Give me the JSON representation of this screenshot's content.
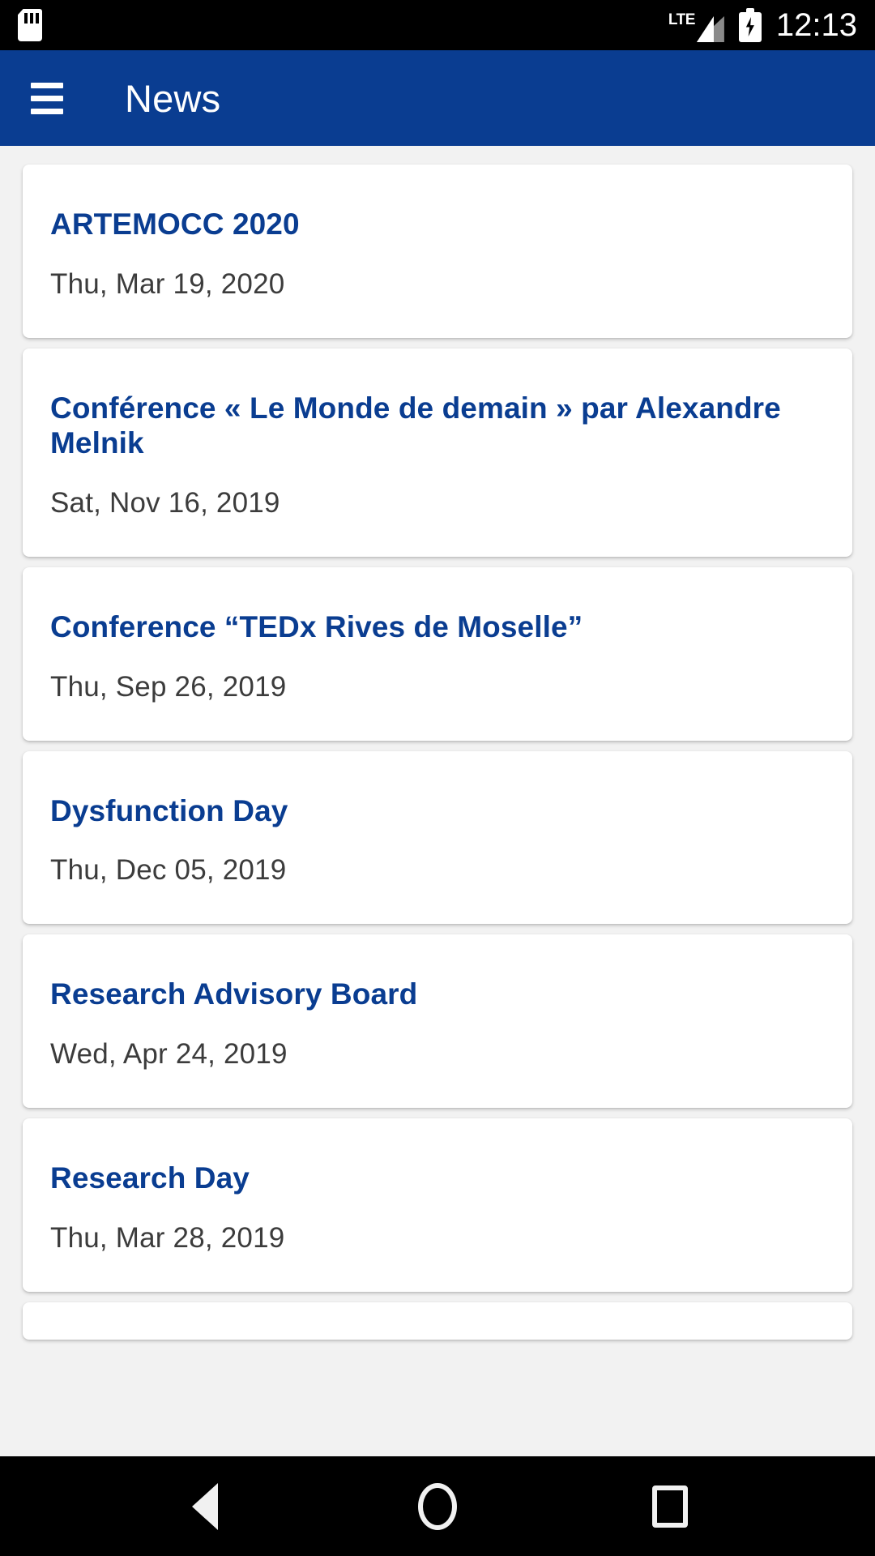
{
  "status_bar": {
    "sd_card_icon": "sd-card-icon",
    "network_label": "LTE",
    "signal_icon": "signal-bars-icon",
    "battery_icon": "battery-charging-icon",
    "time": "12:13"
  },
  "toolbar": {
    "menu_icon": "hamburger-menu-icon",
    "title": "News"
  },
  "theme": {
    "primary": "#0a3d91",
    "background": "#f2f2f2",
    "card": "#ffffff",
    "title_text": "#0a3d91",
    "date_text": "#3c3c3c",
    "system_bar": "#000000"
  },
  "news": {
    "items": [
      {
        "title": "ARTEMOCC 2020",
        "date": "Thu, Mar 19, 2020"
      },
      {
        "title": "Conférence « Le Monde de demain » par Alexandre Melnik",
        "date": "Sat, Nov 16, 2019"
      },
      {
        "title": "Conference “TEDx Rives de Moselle”",
        "date": "Thu, Sep 26, 2019"
      },
      {
        "title": "Dysfunction Day",
        "date": "Thu, Dec 05, 2019"
      },
      {
        "title": "Research Advisory Board",
        "date": "Wed, Apr 24, 2019"
      },
      {
        "title": "Research Day",
        "date": "Thu, Mar 28, 2019"
      }
    ]
  },
  "nav_bar": {
    "back_icon": "back-triangle-icon",
    "home_icon": "home-circle-icon",
    "recents_icon": "recents-square-icon"
  }
}
